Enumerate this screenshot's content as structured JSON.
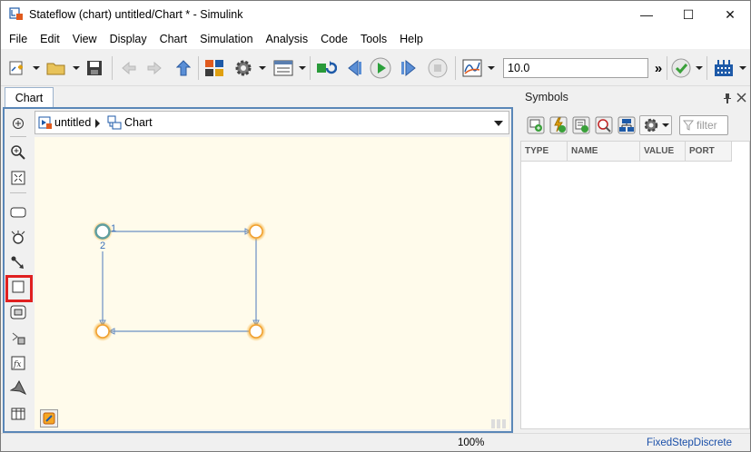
{
  "window": {
    "title": "Stateflow (chart) untitled/Chart * - Simulink",
    "minimize_glyph": "—",
    "maximize_glyph": "☐",
    "close_glyph": "✕"
  },
  "menu": [
    "File",
    "Edit",
    "View",
    "Display",
    "Chart",
    "Simulation",
    "Analysis",
    "Code",
    "Tools",
    "Help"
  ],
  "toolbar": {
    "stop_time": "10.0",
    "more_glyph": "»"
  },
  "editor": {
    "tab_label": "Chart",
    "breadcrumb": {
      "model": "untitled",
      "chart": "Chart"
    },
    "state_numbers": {
      "first": "1",
      "second": "2"
    }
  },
  "symbols": {
    "title": "Symbols",
    "filter_placeholder": "filter",
    "columns": [
      "TYPE",
      "NAME",
      "VALUE",
      "PORT"
    ]
  },
  "status": {
    "zoom": "100%",
    "solver": "FixedStepDiscrete"
  },
  "colors": {
    "editor_border": "#5a87b8",
    "canvas_bg": "#fffbeb",
    "highlight": "#e02020",
    "junction_glow": "#f5a623",
    "transition": "#6a8fc4"
  }
}
